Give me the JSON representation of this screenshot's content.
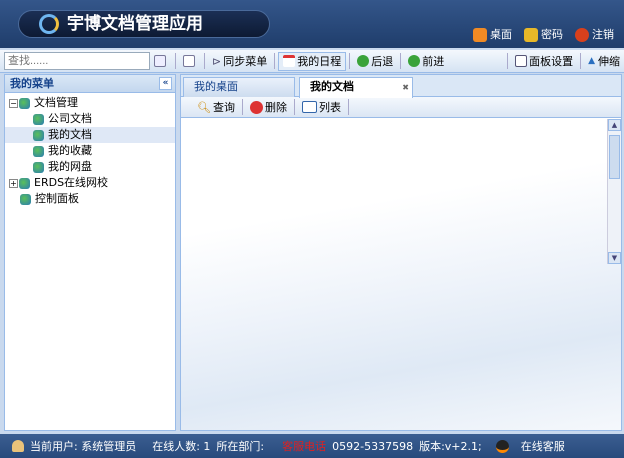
{
  "header": {
    "title": "宇博文档管理应用",
    "links": [
      "桌面",
      "密码",
      "注销"
    ]
  },
  "toolbar": {
    "search_placeholder": "查找......",
    "sync": "同步菜单",
    "schedule": "我的日程",
    "back": "后退",
    "forward": "前进",
    "panel_settings": "面板设置",
    "toggle": "伸缩"
  },
  "menu": {
    "title": "我的菜单",
    "collapse": "«",
    "items": [
      {
        "label": "文档管理"
      },
      {
        "label": "公司文档"
      },
      {
        "label": "我的文档"
      },
      {
        "label": "我的收藏"
      },
      {
        "label": "我的网盘"
      },
      {
        "label": "ERDS在线网校"
      },
      {
        "label": "控制面板"
      }
    ]
  },
  "tabs": [
    {
      "label": "我的桌面"
    },
    {
      "label": "我的文档"
    }
  ],
  "actions": {
    "query": "查询",
    "delete": "删除",
    "list": "列表"
  },
  "status": {
    "user": "当前用户: 系统管理员",
    "online": "在线人数: 1",
    "dept": "所在部门:",
    "hotline_label": "客服电话",
    "phone": "0592-5337598",
    "version": "版本:v+2.1;",
    "service": "在线客服"
  },
  "colors": {
    "header": "#2a4a7c",
    "accent": "#99bbe8",
    "hotline": "#e02020"
  }
}
